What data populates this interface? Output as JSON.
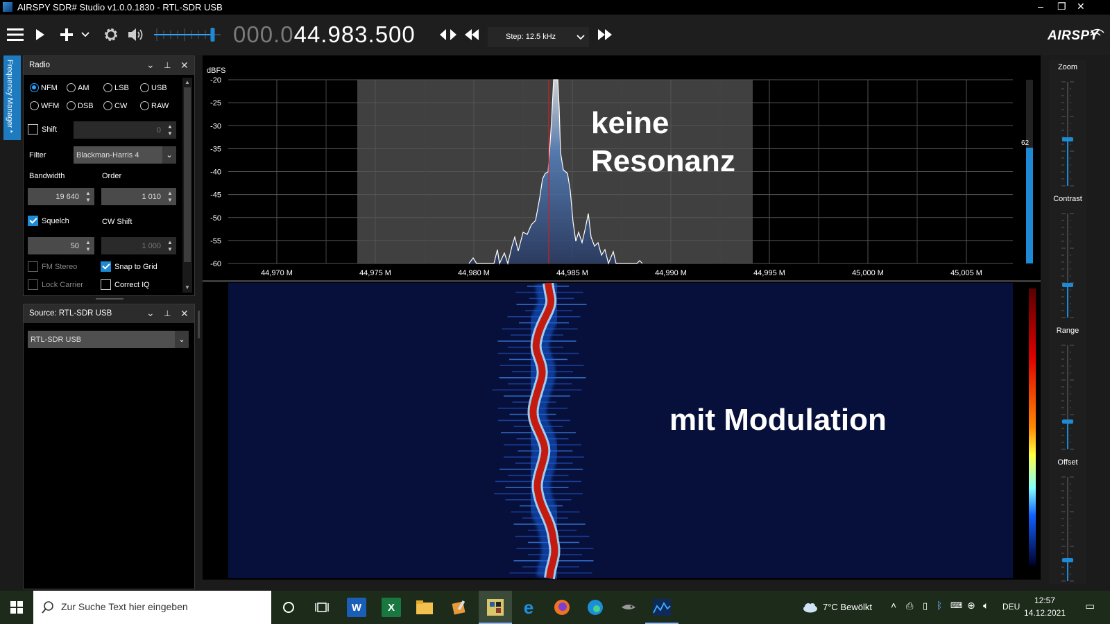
{
  "window": {
    "title": "AIRSPY SDR# Studio v1.0.0.1830 - RTL-SDR USB",
    "minimize": "–",
    "maximize": "❐",
    "close": "✕"
  },
  "toolbar": {
    "frequency_dim": "000.0",
    "frequency_main": "44.983.500",
    "step_label": "Step: 12.5 kHz",
    "brand": "AIRSPY",
    "volume_level": 0.88
  },
  "freq_manager_tab": "Frequency Manager *",
  "radio_panel": {
    "title": "Radio",
    "modes": [
      "NFM",
      "AM",
      "LSB",
      "USB",
      "WFM",
      "DSB",
      "CW",
      "RAW"
    ],
    "selected_mode": "NFM",
    "shift_label": "Shift",
    "shift_value": "0",
    "filter_label": "Filter",
    "filter_value": "Blackman-Harris 4",
    "bandwidth_label": "Bandwidth",
    "bandwidth_value": "19 640",
    "order_label": "Order",
    "order_value": "1 010",
    "squelch_label": "Squelch",
    "squelch_value": "50",
    "cwshift_label": "CW Shift",
    "cwshift_value": "1 000",
    "fm_stereo_label": "FM Stereo",
    "snap_label": "Snap to Grid",
    "lock_carrier_label": "Lock Carrier",
    "correct_iq_label": "Correct IQ"
  },
  "source_panel": {
    "title": "Source: RTL-SDR USB",
    "device": "RTL-SDR USB"
  },
  "spectrum": {
    "y_unit": "dBFS",
    "y_ticks": [
      "-20",
      "-25",
      "-30",
      "-35",
      "-40",
      "-45",
      "-50",
      "-55",
      "-60"
    ],
    "x_ticks": [
      "44,970 M",
      "44,975 M",
      "44,980 M",
      "44,985 M",
      "44,990 M",
      "44,995 M",
      "45,000 M",
      "45,005 M"
    ],
    "annotation_line1": "keine",
    "annotation_line2": "Resonanz",
    "level_readout": "62"
  },
  "waterfall": {
    "annotation": "mit Modulation"
  },
  "right_controls": {
    "zoom": "Zoom",
    "contrast": "Contrast",
    "range": "Range",
    "offset": "Offset"
  },
  "colors": {
    "accent": "#1e8ad6",
    "tuning_line": "#d02020",
    "waterfall_bg": "#07103a",
    "signal": "#c41a10"
  },
  "taskbar": {
    "search_placeholder": "Zur Suche Text hier eingeben",
    "weather": "7°C  Bewölkt",
    "language": "DEU",
    "time": "12:57",
    "date": "14.12.2021"
  }
}
